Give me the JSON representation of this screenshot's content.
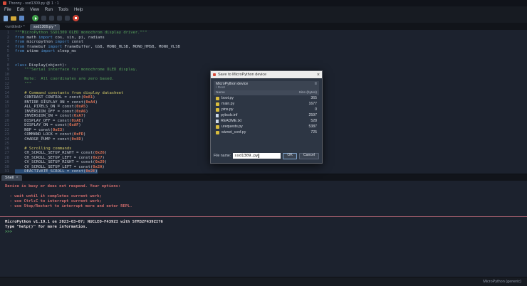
{
  "window": {
    "title": "Thonny  -  ssd1309.py  @  1 : 1"
  },
  "menu": {
    "items": [
      "File",
      "Edit",
      "View",
      "Run",
      "Tools",
      "Help"
    ]
  },
  "toolbar": {
    "icons": [
      {
        "name": "new-file-icon",
        "cls": "icon-page"
      },
      {
        "name": "open-folder-icon",
        "cls": "icon-folder"
      },
      {
        "name": "save-icon",
        "cls": "icon-save"
      },
      {
        "name": "separator",
        "cls": "icon-sep"
      },
      {
        "name": "run-icon",
        "cls": "icon-run"
      },
      {
        "name": "debug-icon",
        "cls": "icon-dim"
      },
      {
        "name": "step-over-icon",
        "cls": "icon-dim"
      },
      {
        "name": "step-into-icon",
        "cls": "icon-dim"
      },
      {
        "name": "step-out-icon",
        "cls": "icon-dim"
      },
      {
        "name": "stop-icon",
        "cls": "icon-stop"
      }
    ]
  },
  "editor": {
    "tabs": [
      {
        "label": "<untitled> *",
        "selected": false
      },
      {
        "label": "ssd1309.py *",
        "selected": true
      }
    ],
    "selected_line": 31,
    "lines": [
      [
        [
          "s",
          "\"\"\"MicroPython SSD1309 OLED monochrom display driver.\"\"\""
        ]
      ],
      [
        [
          "k",
          "from"
        ],
        [
          "d",
          " math "
        ],
        [
          "k",
          "import"
        ],
        [
          "d",
          " cos, sin, pi, radians"
        ]
      ],
      [
        [
          "k",
          "from"
        ],
        [
          "d",
          " micropython "
        ],
        [
          "k",
          "import"
        ],
        [
          "d",
          " const"
        ]
      ],
      [
        [
          "k",
          "from"
        ],
        [
          "d",
          " framebuf "
        ],
        [
          "k",
          "import"
        ],
        [
          "d",
          " FrameBuffer, GS8, MONO_HLSB, MONO_HMSB, MONO_VLSB"
        ]
      ],
      [
        [
          "k",
          "from"
        ],
        [
          "d",
          " utime "
        ],
        [
          "k",
          "import"
        ],
        [
          "d",
          " sleep_ms"
        ]
      ],
      [],
      [],
      [
        [
          "k",
          "class"
        ],
        [
          "d",
          " Display(object):"
        ]
      ],
      [
        [
          "s",
          "    \"\"\"Serial interface for monochrome OLED display."
        ]
      ],
      [],
      [
        [
          "s",
          "    Note:  All coordinates are zero based."
        ]
      ],
      [
        [
          "s",
          "    \"\"\""
        ]
      ],
      [],
      [
        [
          "c",
          "    # Command constants from display datasheet"
        ]
      ],
      [
        [
          "d",
          "    CONTRAST_CONTROL = const("
        ],
        [
          "n",
          "0x81"
        ],
        [
          "d",
          ")"
        ]
      ],
      [
        [
          "d",
          "    ENTIRE_DISPLAY_ON = const("
        ],
        [
          "n",
          "0xA4"
        ],
        [
          "d",
          ")"
        ]
      ],
      [
        [
          "d",
          "    ALL_PIXELS_ON = const("
        ],
        [
          "n",
          "0xA5"
        ],
        [
          "d",
          ")"
        ]
      ],
      [
        [
          "d",
          "    INVERSION_OFF = const("
        ],
        [
          "n",
          "0xA6"
        ],
        [
          "d",
          ")"
        ]
      ],
      [
        [
          "d",
          "    INVERSION_ON = const("
        ],
        [
          "n",
          "0xA7"
        ],
        [
          "d",
          ")"
        ]
      ],
      [
        [
          "d",
          "    DISPLAY_OFF = const("
        ],
        [
          "n",
          "0xAE"
        ],
        [
          "d",
          ")"
        ]
      ],
      [
        [
          "d",
          "    DISPLAY_ON = const("
        ],
        [
          "n",
          "0xAF"
        ],
        [
          "d",
          ")"
        ]
      ],
      [
        [
          "d",
          "    NOP = const("
        ],
        [
          "n",
          "0xE3"
        ],
        [
          "d",
          ")"
        ]
      ],
      [
        [
          "d",
          "    COMMAND_LOCK = const("
        ],
        [
          "n",
          "0xFD"
        ],
        [
          "d",
          ")"
        ]
      ],
      [
        [
          "d",
          "    CHARGE_PUMP = const("
        ],
        [
          "n",
          "0x8D"
        ],
        [
          "d",
          ")"
        ]
      ],
      [],
      [
        [
          "c",
          "    # Scrolling commands"
        ]
      ],
      [
        [
          "d",
          "    CH_SCROLL_SETUP_RIGHT = const("
        ],
        [
          "n",
          "0x26"
        ],
        [
          "d",
          ")"
        ]
      ],
      [
        [
          "d",
          "    CH_SCROLL_SETUP_LEFT = const("
        ],
        [
          "n",
          "0x27"
        ],
        [
          "d",
          ")"
        ]
      ],
      [
        [
          "d",
          "    CV_SCROLL_SETUP_RIGHT = const("
        ],
        [
          "n",
          "0x29"
        ],
        [
          "d",
          ")"
        ]
      ],
      [
        [
          "d",
          "    CV_SCROLL_SETUP_LEFT = const("
        ],
        [
          "n",
          "0x2A"
        ],
        [
          "d",
          ")"
        ]
      ],
      [
        [
          "d",
          "    DEACTIVATE_SCROLL = const("
        ],
        [
          "n",
          "0x2E"
        ],
        [
          "d",
          ")"
        ]
      ]
    ]
  },
  "shell": {
    "tab_label": "Shell",
    "close_glyph": "×",
    "lines": [
      [
        "err",
        "Device is busy or does not respond. Your options:"
      ],
      [
        "err",
        ""
      ],
      [
        "err",
        "  - wait until it completes current work;"
      ],
      [
        "err",
        "  - use Ctrl+C to interrupt current work;"
      ],
      [
        "err",
        "  - use Stop/Restart to interrupt more and enter REPL."
      ],
      [
        "gap",
        ""
      ],
      [
        "hr",
        ""
      ],
      [
        "banner",
        "MicroPython v1.19.1 on 2023-03-07; NUCLEO-F439ZI with STM32F439ZIT6"
      ],
      [
        "banner",
        "Type \"help()\" for more information."
      ],
      [
        "prompt",
        ">>>"
      ]
    ]
  },
  "dialog": {
    "title": "Save to MicroPython device",
    "close_glyph": "×",
    "device_label": "MicroPython device",
    "menu_glyph": "≡",
    "path": "/  Root",
    "columns": [
      "Name",
      "Size (bytes)"
    ],
    "files": [
      {
        "name": "boot.py",
        "size": "365",
        "icon": "py"
      },
      {
        "name": "main.py",
        "size": "1677",
        "icon": "py"
      },
      {
        "name": "pins.py",
        "size": "0",
        "icon": "py"
      },
      {
        "name": "pybcdc.inf",
        "size": "2597",
        "icon": "file"
      },
      {
        "name": "README.txt",
        "size": "528",
        "icon": "file"
      },
      {
        "name": "urequests.py",
        "size": "5387",
        "icon": "py"
      },
      {
        "name": "wiznet_conf.py",
        "size": "725",
        "icon": "py"
      }
    ],
    "file_name_label": "File name:",
    "file_name_value": "ssd1309.py",
    "ok_label": "OK",
    "cancel_label": "Cancel"
  },
  "status_bar": {
    "interpreter": "MicroPython (generic)"
  },
  "colors": {
    "run_green": "#3fa04a",
    "stop_red": "#cf4335",
    "error_red": "#cf6b6b",
    "prompt_green": "#56a866",
    "keyword_blue": "#4f94d4",
    "string_green": "#57a25b",
    "comment_yellow": "#d3ca67",
    "number_orange": "#dd7356",
    "selection_blue": "#2c4e77",
    "py_icon_yellow": "#d8bb3d"
  }
}
